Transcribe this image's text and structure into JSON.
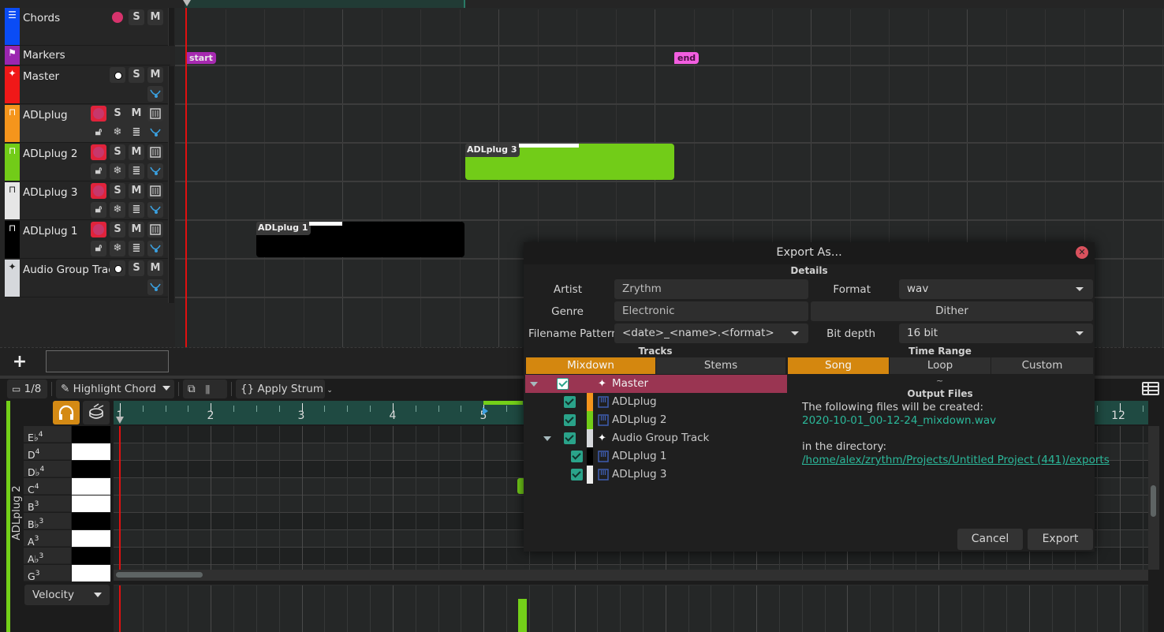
{
  "tracklist": {
    "tracks": [
      {
        "name": "Chords",
        "color": "#0a4cf5",
        "icon": "chord-track-icon",
        "buttons": [
          "record",
          "S",
          "M"
        ]
      },
      {
        "name": "Markers",
        "color": "#9b26b0",
        "icon": "flag-icon",
        "buttons": []
      },
      {
        "name": "Master",
        "color": "#f01818",
        "icon": "master-sparkle-icon",
        "buttons": [
          "listen",
          "S",
          "M",
          "automation"
        ]
      },
      {
        "name": "ADLplug",
        "color": "#f5951c",
        "icon": "midi-keyboard-icon",
        "buttons": [
          "record",
          "S",
          "M",
          "instrument",
          "lock",
          "freeze",
          "lanes",
          "automation"
        ]
      },
      {
        "name": "ADLplug 2",
        "color": "#72cc18",
        "icon": "midi-keyboard-icon",
        "buttons": [
          "record",
          "S",
          "M",
          "instrument",
          "lock",
          "freeze",
          "lanes",
          "automation"
        ]
      },
      {
        "name": "ADLplug 3",
        "color": "#e6e6e6",
        "icon": "midi-keyboard-icon",
        "buttons": [
          "record",
          "S",
          "M",
          "instrument",
          "lock",
          "freeze",
          "lanes",
          "automation"
        ]
      },
      {
        "name": "ADLplug 1",
        "color": "#000000",
        "icon": "midi-keyboard-icon",
        "buttons": [
          "record",
          "S",
          "M",
          "instrument",
          "lock",
          "freeze",
          "lanes",
          "automation"
        ]
      },
      {
        "name": "Audio Group Track",
        "color": "#d6d8dc",
        "icon": "group-sparkle-icon",
        "buttons": [
          "listen",
          "S",
          "M",
          "automation"
        ]
      }
    ],
    "solo_label": "S",
    "mute_label": "M"
  },
  "arranger": {
    "markers": [
      {
        "label": "start",
        "color": "#a62ab0"
      },
      {
        "label": "end",
        "color": "#f25ee0"
      }
    ],
    "regions": [
      {
        "label": "ADLplug 3",
        "track": "ADLplug 2",
        "color": "#72cc18"
      },
      {
        "label": "ADLplug 1",
        "track": "ADLplug 1",
        "color": "#000000"
      }
    ]
  },
  "add_track": {
    "button_label": "+",
    "input_value": ""
  },
  "editor": {
    "toolbar": {
      "snap_label": "1/8",
      "highlight_label": "Highlight Chord",
      "strum_label": "Apply Strum"
    },
    "track_label": "ADLplug 2",
    "ruler_numbers": [
      "1",
      "2",
      "3",
      "4",
      "5",
      "12"
    ],
    "keys": [
      {
        "note": "E",
        "acc": "♭",
        "oct": "4",
        "black": true
      },
      {
        "note": "D",
        "acc": "",
        "oct": "4",
        "black": false
      },
      {
        "note": "D",
        "acc": "♭",
        "oct": "4",
        "black": true
      },
      {
        "note": "C",
        "acc": "",
        "oct": "4",
        "black": false
      },
      {
        "note": "B",
        "acc": "",
        "oct": "3",
        "black": false
      },
      {
        "note": "B",
        "acc": "♭",
        "oct": "3",
        "black": true
      },
      {
        "note": "A",
        "acc": "",
        "oct": "3",
        "black": false
      },
      {
        "note": "A",
        "acc": "♭",
        "oct": "3",
        "black": true
      },
      {
        "note": "G",
        "acc": "",
        "oct": "3",
        "black": false
      }
    ],
    "velocity_label": "Velocity",
    "accent_color": "#74d019"
  },
  "dialog": {
    "title": "Export As...",
    "details_header": "Details",
    "artist_label": "Artist",
    "artist_placeholder": "Zrythm",
    "genre_label": "Genre",
    "genre_placeholder": "Electronic",
    "filename_label": "Filename Pattern",
    "filename_value": "<date>_<name>.<format>",
    "format_label": "Format",
    "format_value": "wav",
    "dither_label": "Dither",
    "bitdepth_label": "Bit depth",
    "bitdepth_value": "16 bit",
    "tracks_header": "Tracks",
    "tracks_modes": [
      {
        "label": "Mixdown",
        "active": true
      },
      {
        "label": "Stems",
        "active": false
      }
    ],
    "time_range_header": "Time Range",
    "time_modes": [
      {
        "label": "Song",
        "active": true
      },
      {
        "label": "Loop",
        "active": false
      },
      {
        "label": "Custom",
        "active": false
      }
    ],
    "tree": [
      {
        "label": "Master",
        "checked": true,
        "expanded": true,
        "depth": 0,
        "color": "",
        "icon": "master-sparkle-icon",
        "selected": true
      },
      {
        "label": "ADLplug",
        "checked": true,
        "depth": 1,
        "color": "#f5951c",
        "icon": "midi-keyboard-icon"
      },
      {
        "label": "ADLplug 2",
        "checked": true,
        "depth": 1,
        "color": "#72cc18",
        "icon": "midi-keyboard-icon"
      },
      {
        "label": "Audio Group Track",
        "checked": true,
        "expanded": true,
        "depth": 1,
        "color": "#d6d8dc",
        "icon": "group-sparkle-icon"
      },
      {
        "label": "ADLplug 1",
        "checked": true,
        "depth": 2,
        "color": "#000000",
        "icon": "midi-keyboard-icon"
      },
      {
        "label": "ADLplug 3",
        "checked": true,
        "depth": 2,
        "color": "#eeeeee",
        "icon": "midi-keyboard-icon"
      }
    ],
    "tilde": "~",
    "output_header": "Output Files",
    "output_intro": "The following files will be created:",
    "output_file": "2020-10-01_00-12-24_mixdown.wav",
    "output_dir_intro": "in the directory:",
    "output_dir": "/home/alex/zrythm/Projects/Untitled Project (441)/exports",
    "cancel_label": "Cancel",
    "export_label": "Export",
    "accent_color": "#d4870f",
    "link_color": "#2bb89a"
  }
}
